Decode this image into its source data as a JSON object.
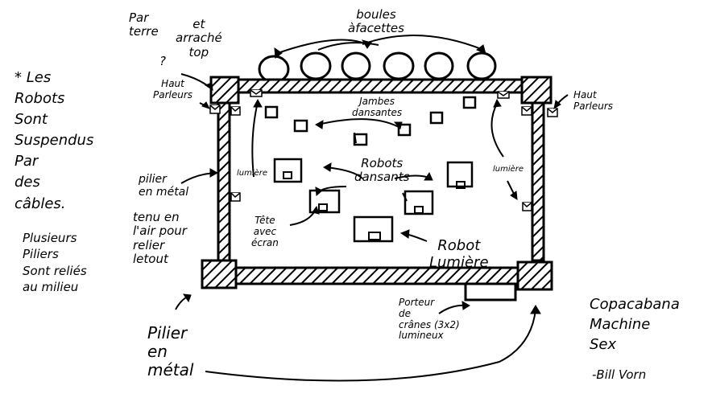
{
  "labels": {
    "boules_a_facettes": "boules\nàfacettes",
    "par_terre": "Par\nterre",
    "et_arrache_top": "et\narraché\ntop",
    "question_mark": "?",
    "haut_parleurs_left": "Haut\nParleurs",
    "haut_parleurs_right": "Haut\nParleurs",
    "jambes_dansantes": "Jambes\ndansantes",
    "robots_dansants": "Robots\ndansants",
    "lumiere_left": "lumière",
    "lumiere_right": "lumière",
    "pilier_en_metal_left": "pilier\nen métal",
    "tenu_en_lair": "tenu en\nl'air pour\nrelier\nletout",
    "tete_avec_ecran": "Tête\navec\nécran",
    "robot_lumiere": "Robot\nLumière",
    "porteur_de_cranes": "Porteur\nde\ncrânes (3x2)\nlumineux",
    "pilier_en_metal_bottom": "Pilier\nen\nmétal",
    "note_asterisk": "* Les\nRobots\nSont\nSuspendus\nPar\ndes\ncâbles.",
    "note_piliers": "Plusieurs\nPiliers\nSont reliés\nau milieu",
    "title": "Copacabana\nMachine\nSex",
    "author": "-Bill Vorn"
  },
  "colors": {
    "ink": "#000000",
    "background": "#ffffff"
  }
}
